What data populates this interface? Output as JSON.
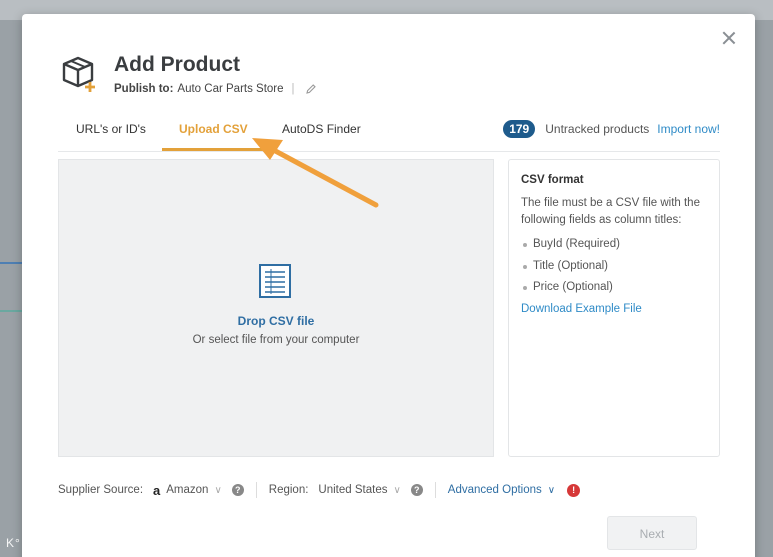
{
  "modal": {
    "title": "Add Product",
    "publish_label": "Publish to:",
    "store_name": "Auto Car Parts Store",
    "separator": "|"
  },
  "tabs": [
    {
      "label": "URL's or ID's",
      "active": false
    },
    {
      "label": "Upload CSV",
      "active": true
    },
    {
      "label": "AutoDS Finder",
      "active": false
    }
  ],
  "untracked": {
    "count": "179",
    "text": "Untracked products",
    "link": "Import now!"
  },
  "drop_area": {
    "title": "Drop CSV file",
    "subtitle": "Or select file from your computer"
  },
  "csv_format": {
    "title": "CSV format",
    "description": "The file must be a CSV file with the following fields as column titles:",
    "fields": [
      "BuyId (Required)",
      "Title (Optional)",
      "Price (Optional)"
    ],
    "download_link": "Download Example File"
  },
  "footer": {
    "supplier_label": "Supplier Source:",
    "supplier_logo": "a",
    "supplier_value": "Amazon",
    "help_glyph": "?",
    "region_label": "Region:",
    "region_value": "United States",
    "advanced_label": "Advanced Options",
    "alert_glyph": "!"
  },
  "next_button": "Next",
  "watermark": "K° 大数跨境",
  "colors": {
    "accent": "#e3a13a",
    "link": "#2f8bc7",
    "badge": "#1e5b8c",
    "alert": "#d63838"
  }
}
